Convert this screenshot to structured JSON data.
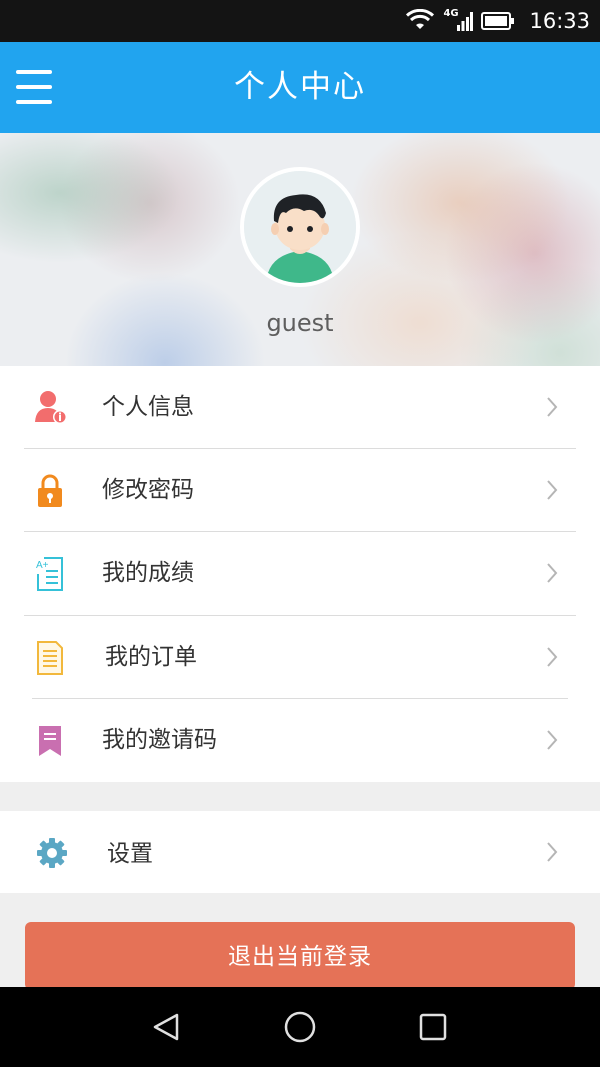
{
  "status_bar": {
    "time": "16:33",
    "network": "4G"
  },
  "app_bar": {
    "title": "个人中心",
    "menu_icon": "hamburger-menu-icon"
  },
  "profile": {
    "username": "guest",
    "avatar_icon": "boy-avatar-icon"
  },
  "menu": {
    "items": [
      {
        "label": "个人信息",
        "icon": "user-info-icon",
        "icon_color": "#f26d6d"
      },
      {
        "label": "修改密码",
        "icon": "lock-icon",
        "icon_color": "#f18a1e"
      },
      {
        "label": "我的成绩",
        "icon": "grades-icon",
        "icon_color": "#35c1d8"
      },
      {
        "label": "我的订单",
        "icon": "order-document-icon",
        "icon_color": "#f2b83c"
      },
      {
        "label": "我的邀请码",
        "icon": "bookmark-icon",
        "icon_color": "#c96fb0"
      }
    ]
  },
  "settings": {
    "label": "设置",
    "icon": "gear-icon",
    "icon_color": "#5ba7c4"
  },
  "logout": {
    "label": "退出当前登录",
    "color": "#e57257"
  },
  "colors": {
    "app_bar": "#21a4ef"
  }
}
